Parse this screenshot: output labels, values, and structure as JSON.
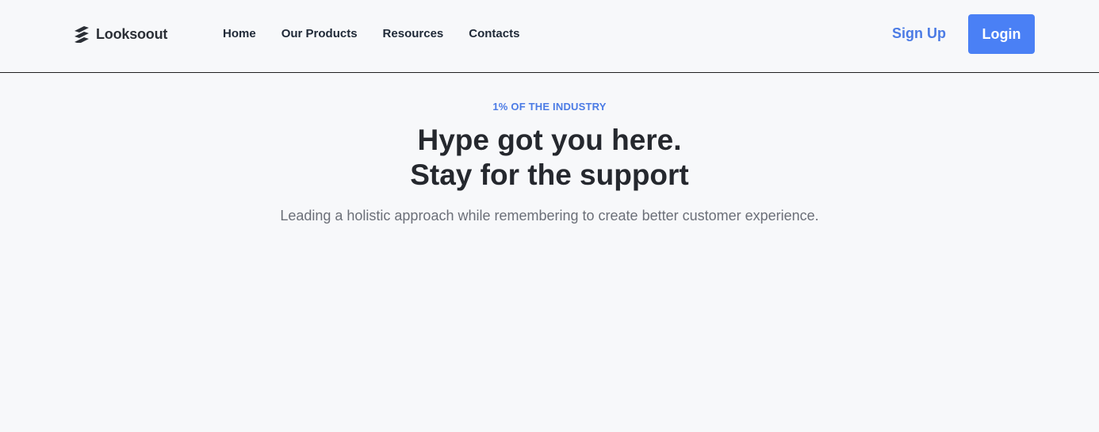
{
  "brand": {
    "name": "Looksoout"
  },
  "nav": {
    "items": [
      {
        "label": "Home"
      },
      {
        "label": "Our Products"
      },
      {
        "label": "Resources"
      },
      {
        "label": "Contacts"
      }
    ]
  },
  "auth": {
    "signup_label": "Sign Up",
    "login_label": "Login"
  },
  "hero": {
    "eyebrow": "1% OF THE INDUSTRY",
    "headline_line1": "Hype got you here.",
    "headline_line2": "Stay for the support",
    "subtitle": "Leading a holistic approach while remembering to create better customer experience."
  },
  "colors": {
    "accent": "#4a80f5",
    "link_accent": "#4b7be5",
    "background": "#f7f8fa",
    "heading": "#25282e",
    "muted": "#6b6f78"
  },
  "icons": {
    "logo": "stacked-slash-logo-icon"
  }
}
